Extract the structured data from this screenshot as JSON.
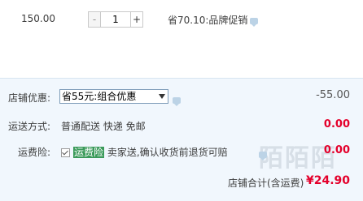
{
  "item": {
    "price": "150.00",
    "minus_label": "-",
    "quantity": "1",
    "plus_label": "+",
    "promo_text": "省70.10:品牌促销"
  },
  "shop_discount": {
    "label": "店铺优惠:",
    "selected_option": "省55元:组合优惠",
    "amount": "-55.00"
  },
  "shipping": {
    "label": "运送方式:",
    "method": "普通配送 快递 免邮",
    "amount": "0.00"
  },
  "shipping_insurance": {
    "label": "运费险:",
    "highlight": "运费险",
    "description": "卖家送,确认收货前退货可赔",
    "amount": "0.00"
  },
  "total": {
    "label": "店铺合计(含运费)",
    "amount": "¥24.90"
  },
  "watermark": "陌陌陌",
  "colors": {
    "price_red": "#e4002b",
    "panel_bg": "#f1f7fd",
    "insurance_highlight": "#3a9a5a"
  }
}
